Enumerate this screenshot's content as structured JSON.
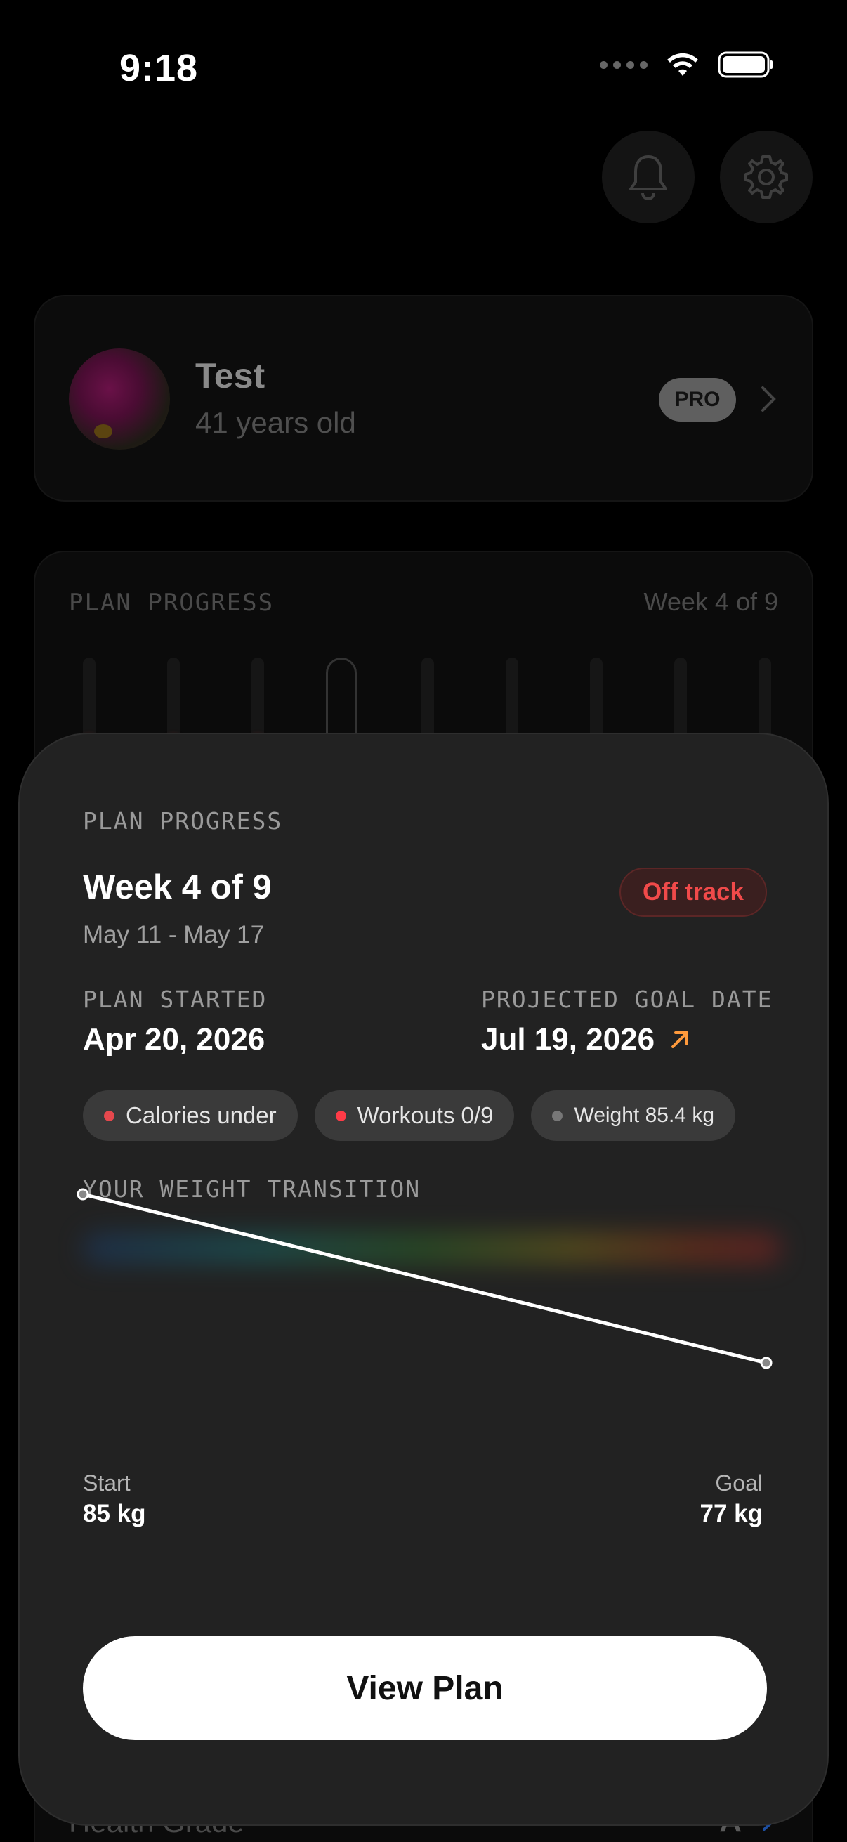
{
  "status_bar": {
    "time": "9:18"
  },
  "header": {
    "icons": [
      "bell-icon",
      "gear-icon"
    ]
  },
  "profile": {
    "name": "Test",
    "age": "41 years old",
    "badge": "PRO"
  },
  "background_plan": {
    "title": "PLAN PROGRESS",
    "week": "Week 4 of 9",
    "health_label": "Health Grade",
    "health_grade": "A"
  },
  "sheet": {
    "section_label": "PLAN PROGRESS",
    "week_title": "Week 4 of 9",
    "week_range": "May 11 - May 17",
    "status_badge": "Off track",
    "plan_started_label": "PLAN STARTED",
    "plan_started_value": "Apr 20, 2026",
    "projected_label": "PROJECTED GOAL DATE",
    "projected_value": "Jul 19, 2026",
    "chips": [
      {
        "label": "Calories under",
        "dot_color": "#e5484d"
      },
      {
        "label": "Workouts 0/9",
        "dot_color": "#ff3b47"
      },
      {
        "label": "Weight 85.4 kg",
        "dot_color": "#777777"
      }
    ],
    "transition_label": "YOUR WEIGHT TRANSITION",
    "start_label": "Start",
    "start_value": "85 kg",
    "goal_label": "Goal",
    "goal_value": "77 kg",
    "button_label": "View Plan"
  },
  "chart_data": {
    "type": "line",
    "x": [
      "Start",
      "Goal"
    ],
    "series": [
      {
        "values": [
          85,
          77
        ]
      }
    ],
    "ylim": [
      77,
      85
    ]
  },
  "colors": {
    "accent_orange": "#ff9a3c",
    "off_track_red": "#f04a4a",
    "sheet_bg": "#222222"
  }
}
